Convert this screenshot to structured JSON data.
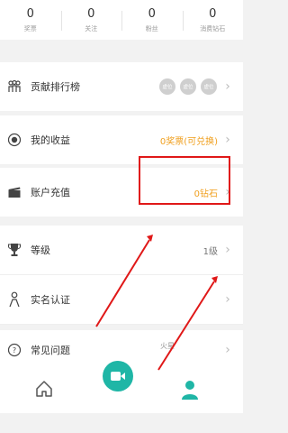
{
  "stats": [
    {
      "value": "0",
      "label": "奖票"
    },
    {
      "value": "0",
      "label": "关注"
    },
    {
      "value": "0",
      "label": "粉丝"
    },
    {
      "value": "0",
      "label": "消费钻石"
    }
  ],
  "menu": {
    "ranking": {
      "label": "贡献排行榜",
      "badges": [
        "虚位",
        "虚位",
        "虚位"
      ]
    },
    "income": {
      "label": "我的收益",
      "value": "0奖票(可兑换)"
    },
    "recharge": {
      "label": "账户充值",
      "value": "0钻石"
    },
    "level": {
      "label": "等级",
      "value": "1级"
    },
    "verify": {
      "label": "实名认证",
      "value": ""
    },
    "faq": {
      "label": "常见问题",
      "value": ""
    }
  },
  "overlay_hint": "火星",
  "tabbar": {
    "home_icon": "home-icon",
    "live_icon": "live-camera-icon",
    "me_icon": "user-icon"
  },
  "colors": {
    "accent": "#1fb6a6",
    "gold": "#f0a020",
    "annotation_red": "#e01818"
  }
}
